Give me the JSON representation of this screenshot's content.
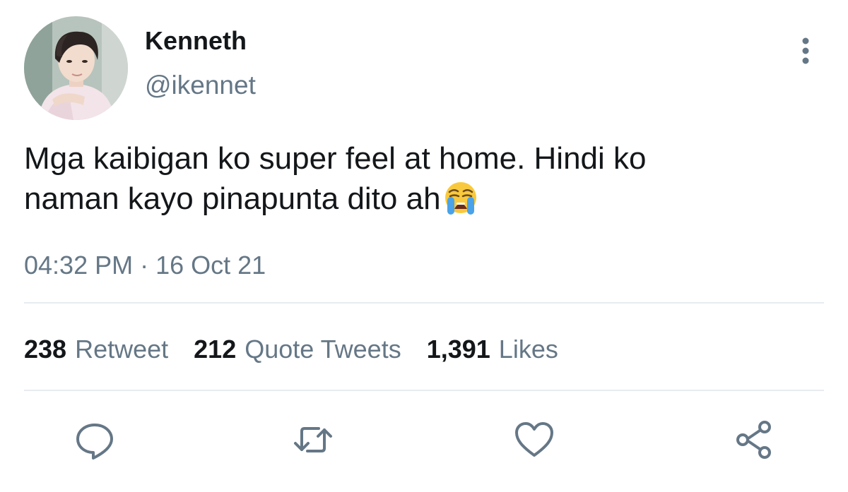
{
  "tweet": {
    "author": {
      "display_name": "Kenneth",
      "handle": "@ikennet",
      "avatar_icon": "profile-photo"
    },
    "text_line1": "Mga kaibigan ko super feel at home. Hindi ko",
    "text_line2": "naman kayo pinapunta dito ah",
    "emoji": "loudly-crying-face",
    "timestamp": "04:32 PM · 16 Oct 21"
  },
  "stats": {
    "retweets_count": "238",
    "retweets_label": "Retweet",
    "quotes_count": "212",
    "quotes_label": "Quote Tweets",
    "likes_count": "1,391",
    "likes_label": "Likes"
  },
  "actions": {
    "reply_icon": "reply-icon",
    "retweet_icon": "retweet-icon",
    "like_icon": "heart-icon",
    "share_icon": "share-icon",
    "more_icon": "more-vertical-icon"
  },
  "colors": {
    "text_primary": "#14171a",
    "text_secondary": "#657786",
    "divider": "#e6ecf0",
    "icon": "#657786"
  }
}
